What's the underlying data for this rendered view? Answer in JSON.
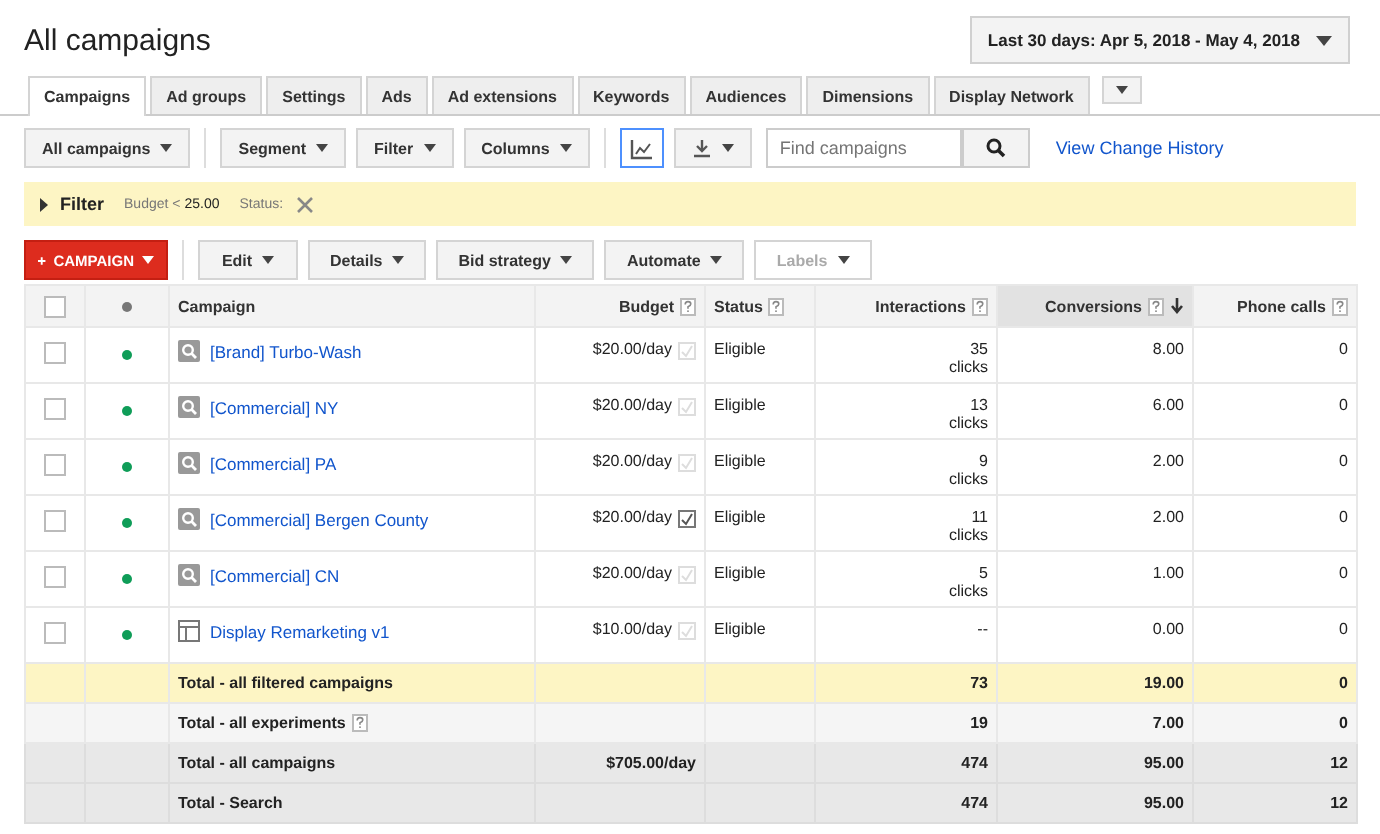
{
  "page_title": "All campaigns",
  "date_range": "Last 30 days: Apr 5, 2018 - May 4, 2018",
  "tabs": [
    {
      "label": "Campaigns",
      "selected": true
    },
    {
      "label": "Ad groups",
      "selected": false
    },
    {
      "label": "Settings",
      "selected": false
    },
    {
      "label": "Ads",
      "selected": false
    },
    {
      "label": "Ad extensions",
      "selected": false
    },
    {
      "label": "Keywords",
      "selected": false
    },
    {
      "label": "Audiences",
      "selected": false
    },
    {
      "label": "Dimensions",
      "selected": false
    },
    {
      "label": "Display Network",
      "selected": false
    }
  ],
  "toolbar": {
    "buttons": [
      "All campaigns",
      "Segment",
      "Filter",
      "Columns"
    ],
    "chart_toggle": {
      "on": true
    },
    "search": {
      "placeholder": "Find campaigns"
    },
    "link": "View Change History"
  },
  "filter_bar": {
    "title": "Filter",
    "conditions": [
      {
        "label": "Budget <",
        "value": "25.00"
      },
      {
        "label": "Status:"
      }
    ]
  },
  "actions": {
    "primary": "CAMPAIGN",
    "buttons": [
      {
        "label": "Edit",
        "disabled": false
      },
      {
        "label": "Details",
        "disabled": false
      },
      {
        "label": "Bid strategy",
        "disabled": false
      },
      {
        "label": "Automate",
        "disabled": false
      },
      {
        "label": "Labels",
        "disabled": true
      }
    ]
  },
  "table": {
    "select_all_checked": false,
    "columns": [
      {
        "label": "Campaign",
        "help": false,
        "sorted": false
      },
      {
        "label": "Budget",
        "help": true,
        "sorted": false
      },
      {
        "label": "Status",
        "help": true,
        "sorted": false
      },
      {
        "label": "Interactions",
        "help": true,
        "sorted": false
      },
      {
        "label": "Conversions",
        "help": true,
        "sorted": true
      },
      {
        "label": "Phone calls",
        "help": true,
        "sorted": false
      }
    ],
    "rows": [
      {
        "checked": false,
        "color": "#0f9d58",
        "kind": "search",
        "name": "[Brand] Turbo-Wash",
        "budget": "$20.00/day",
        "budget_checked": false,
        "status": "Eligible",
        "interactions": "35",
        "interactions_unit": "clicks",
        "conversions": "8.00",
        "phone_calls": "0"
      },
      {
        "checked": false,
        "color": "#0f9d58",
        "kind": "search",
        "name": "[Commercial] NY",
        "budget": "$20.00/day",
        "budget_checked": false,
        "status": "Eligible",
        "interactions": "13",
        "interactions_unit": "clicks",
        "conversions": "6.00",
        "phone_calls": "0"
      },
      {
        "checked": false,
        "color": "#0f9d58",
        "kind": "search",
        "name": "[Commercial] PA",
        "budget": "$20.00/day",
        "budget_checked": false,
        "status": "Eligible",
        "interactions": "9",
        "interactions_unit": "clicks",
        "conversions": "2.00",
        "phone_calls": "0"
      },
      {
        "checked": false,
        "color": "#0f9d58",
        "kind": "search",
        "name": "[Commercial] Bergen County",
        "budget": "$20.00/day",
        "budget_checked": true,
        "status": "Eligible",
        "interactions": "11",
        "interactions_unit": "clicks",
        "conversions": "2.00",
        "phone_calls": "0"
      },
      {
        "checked": false,
        "color": "#0f9d58",
        "kind": "search",
        "name": "[Commercial] CN",
        "budget": "$20.00/day",
        "budget_checked": false,
        "status": "Eligible",
        "interactions": "5",
        "interactions_unit": "clicks",
        "conversions": "1.00",
        "phone_calls": "0"
      },
      {
        "checked": false,
        "color": "#0f9d58",
        "kind": "display",
        "name": "Display Remarketing v1",
        "budget": "$10.00/day",
        "budget_checked": false,
        "status": "Eligible",
        "interactions": "--",
        "conversions": "0.00",
        "phone_calls": "0"
      }
    ],
    "totals": [
      {
        "kind": "filtered",
        "label": "Total - all filtered campaigns",
        "help": false,
        "interactions": "73",
        "conversions": "19.00",
        "phone_calls": "0"
      },
      {
        "kind": "experiments",
        "label": "Total - all experiments",
        "help": true,
        "interactions": "19",
        "conversions": "7.00",
        "phone_calls": "0"
      },
      {
        "kind": "all",
        "label": "Total - all campaigns",
        "help": false,
        "budget": "$705.00/day",
        "interactions": "474",
        "conversions": "95.00",
        "phone_calls": "12"
      },
      {
        "kind": "all",
        "label": "Total - Search",
        "help": false,
        "interactions": "474",
        "conversions": "95.00",
        "phone_calls": "12"
      }
    ]
  }
}
